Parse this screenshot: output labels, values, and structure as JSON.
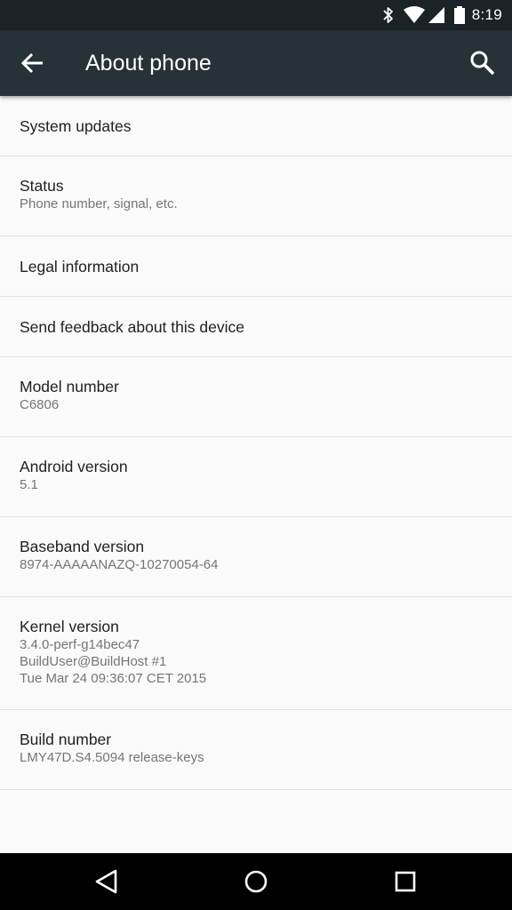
{
  "status_bar": {
    "time": "8:19",
    "icons": [
      "bluetooth-icon",
      "wifi-icon",
      "cell-signal-icon",
      "battery-icon"
    ]
  },
  "app_bar": {
    "title": "About phone",
    "back_icon": "arrow-back-icon",
    "search_icon": "search-icon"
  },
  "items": [
    {
      "title": "System updates"
    },
    {
      "title": "Status",
      "subtitle": "Phone number, signal, etc."
    },
    {
      "title": "Legal information"
    },
    {
      "title": "Send feedback about this device"
    },
    {
      "title": "Model number",
      "subtitle": "C6806"
    },
    {
      "title": "Android version",
      "subtitle": "5.1"
    },
    {
      "title": "Baseband version",
      "subtitle": "8974-AAAAANAZQ-10270054-64"
    },
    {
      "title": "Kernel version",
      "subtitle": "3.4.0-perf-g14bec47\nBuildUser@BuildHost #1\nTue Mar 24 09:36:07 CET 2015"
    },
    {
      "title": "Build number",
      "subtitle": "LMY47D.S4.5094 release-keys"
    }
  ],
  "nav_bar": {
    "back_icon": "nav-back-icon",
    "home_icon": "nav-home-icon",
    "recents_icon": "nav-recents-icon"
  },
  "colors": {
    "status_bar_bg": "#1b2327",
    "app_bar_bg": "#263238",
    "background": "#fafafa",
    "primary_text": "#212121",
    "secondary_text": "#757575",
    "divider": "#e2e2e2"
  }
}
